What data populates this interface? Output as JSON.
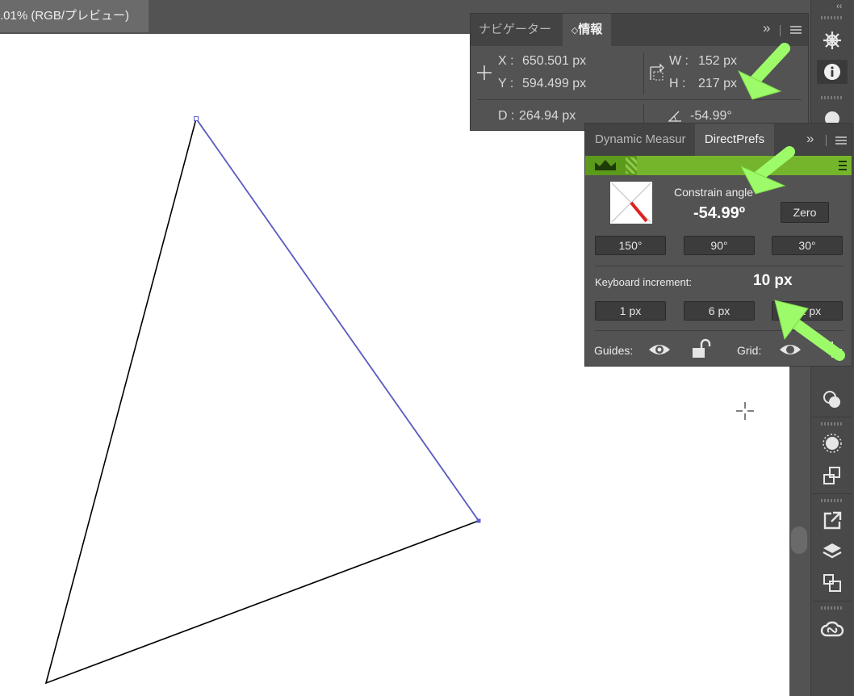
{
  "document": {
    "tab_title": ".01% (RGB/プレビュー)"
  },
  "info_panel": {
    "tabs": [
      "ナビゲーター",
      "情報"
    ],
    "tab_info_prefix": "◇",
    "x_label": "X :",
    "x_value": "650.501 px",
    "y_label": "Y :",
    "y_value": "594.499 px",
    "w_label": "W :",
    "w_value": "152 px",
    "h_label": "H :",
    "h_value": "217 px",
    "d_label": "D :",
    "d_value": "264.94 px",
    "angle_value": "-54.99°",
    "menu_chevrons": "»"
  },
  "directprefs_panel": {
    "tabs": [
      "Dynamic Measur",
      "DirectPrefs"
    ],
    "menu_chevrons": "»",
    "constrain_label": "Constrain angle",
    "constrain_value": "-54.99º",
    "zero_button": "Zero",
    "angle_buttons": [
      "150°",
      "90°",
      "30°"
    ],
    "keyboard_label": "Keyboard increment:",
    "keyboard_value": "10 px",
    "increment_buttons": [
      "1 px",
      "6 px",
      "12 px"
    ],
    "guides_label": "Guides:",
    "grid_label": "Grid:"
  },
  "dock": {
    "icons": [
      "helm-icon",
      "info-icon",
      "cloud-icon",
      "shape-builder-icon",
      "brightness-icon",
      "transform-icon",
      "export-icon",
      "layers-icon",
      "artboards-icon",
      "creative-cloud-icon"
    ]
  },
  "colors": {
    "accent_green": "#75b52b",
    "annotation_arrow": "#9dfb6a",
    "selection_blue": "#5d5fd1"
  }
}
